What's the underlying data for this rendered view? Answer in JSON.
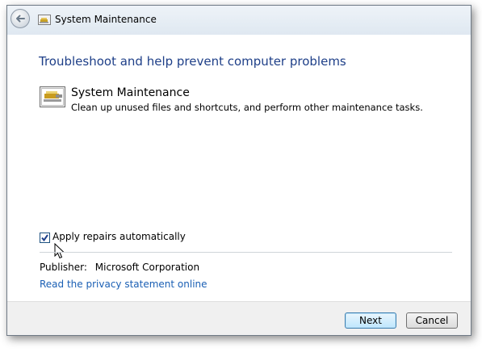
{
  "window": {
    "title": "System Maintenance",
    "back_icon": "back-arrow-icon",
    "title_icon": "system-maintenance-icon"
  },
  "main": {
    "heading": "Troubleshoot and help prevent computer problems",
    "task": {
      "title": "System Maintenance",
      "description": "Clean up unused files and shortcuts, and perform other maintenance tasks.",
      "icon": "system-maintenance-icon"
    },
    "apply_repairs": {
      "label": "Apply repairs automatically",
      "checked": true
    },
    "publisher": {
      "label": "Publisher:",
      "value": "Microsoft Corporation"
    },
    "privacy_link": "Read the privacy statement online"
  },
  "footer": {
    "next_label": "Next",
    "cancel_label": "Cancel"
  },
  "colors": {
    "heading": "#1e3f88",
    "link": "#1a5fb4",
    "footer_bg": "#f0f0f0"
  }
}
